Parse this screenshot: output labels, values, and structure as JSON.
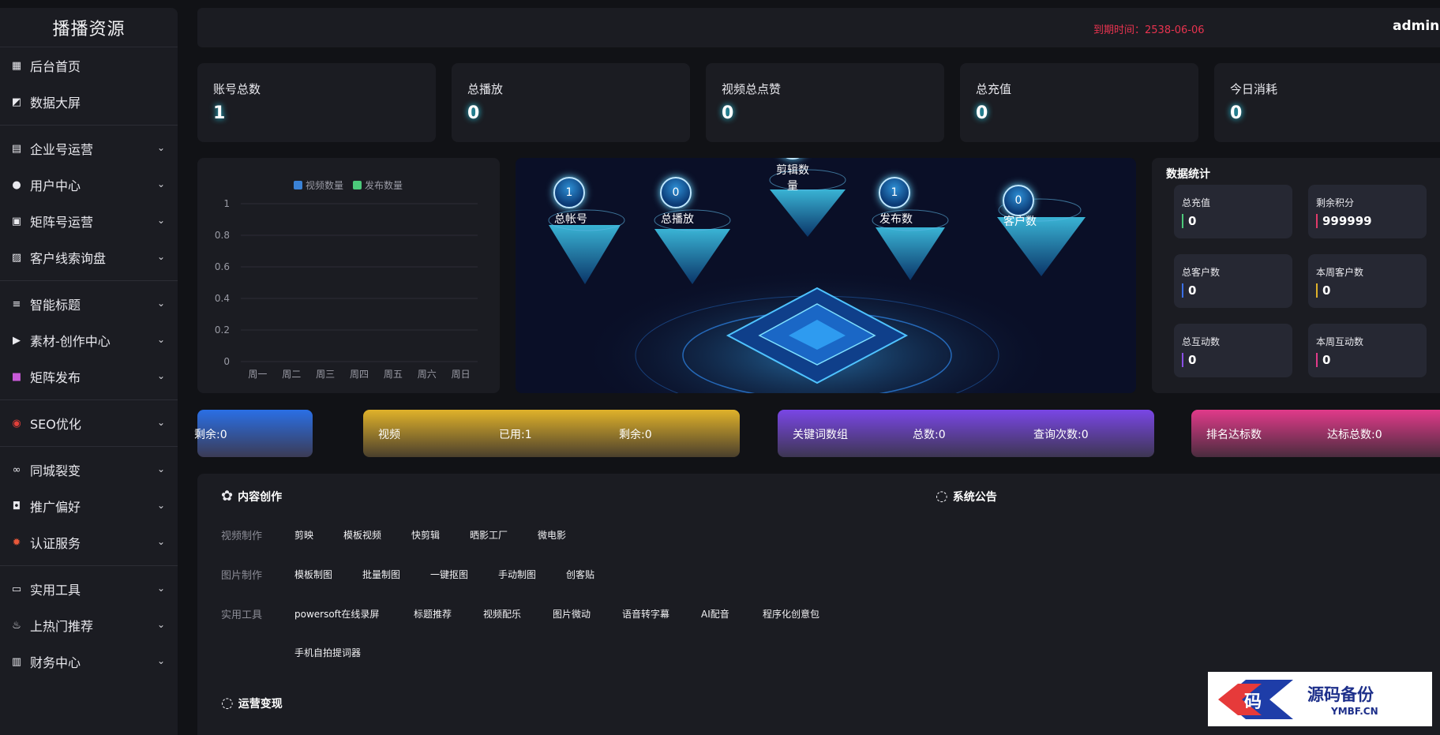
{
  "sidebar": {
    "brand": "播播资源",
    "items": [
      {
        "label": "后台首页",
        "icon": "dashboard-icon"
      },
      {
        "label": "数据大屏",
        "icon": "chart-icon"
      },
      {
        "label": "企业号运营",
        "icon": "building-icon"
      },
      {
        "label": "用户中心",
        "icon": "user-icon"
      },
      {
        "label": "矩阵号运营",
        "icon": "matrix-icon"
      },
      {
        "label": "客户线索询盘",
        "icon": "image-icon"
      },
      {
        "label": "智能标题",
        "icon": "list-icon"
      },
      {
        "label": "素材-创作中心",
        "icon": "play-icon"
      },
      {
        "label": "矩阵发布",
        "icon": "video-icon"
      },
      {
        "label": "SEO优化",
        "icon": "seo-icon"
      },
      {
        "label": "同城裂变",
        "icon": "link-icon"
      },
      {
        "label": "推广偏好",
        "icon": "robot-icon"
      },
      {
        "label": "认证服务",
        "icon": "badge-icon"
      },
      {
        "label": "实用工具",
        "icon": "toolbox-icon"
      },
      {
        "label": "上热门推荐",
        "icon": "fire-icon"
      },
      {
        "label": "财务中心",
        "icon": "wallet-icon"
      }
    ]
  },
  "topbar": {
    "expire": "到期时间：2538-06-06",
    "user": "admin"
  },
  "stats": [
    {
      "label": "账号总数",
      "value": "1"
    },
    {
      "label": "总播放",
      "value": "0"
    },
    {
      "label": "视频总点赞",
      "value": "0"
    },
    {
      "label": "总充值",
      "value": "0"
    },
    {
      "label": "今日消耗",
      "value": "0"
    }
  ],
  "chart_data": {
    "type": "bar",
    "categories": [
      "周一",
      "周二",
      "周三",
      "周四",
      "周五",
      "周六",
      "周日"
    ],
    "series": [
      {
        "name": "视频数量",
        "values": [
          0,
          0,
          0,
          0,
          0,
          0,
          0
        ],
        "color": "#3a82d6"
      },
      {
        "name": "发布数量",
        "values": [
          0,
          0,
          0,
          0,
          0,
          0,
          0
        ],
        "color": "#4cc97a"
      }
    ],
    "yticks": [
      "0",
      "0.2",
      "0.4",
      "0.6",
      "0.8",
      "1"
    ],
    "ylim": [
      0,
      1
    ],
    "legend": "top-center",
    "grid": true
  },
  "visual": {
    "items": [
      {
        "label": "总帐号",
        "value": "1"
      },
      {
        "label": "总播放",
        "value": "0"
      },
      {
        "label": "剪辑数量",
        "value": "0"
      },
      {
        "label": "发布数",
        "value": "1"
      },
      {
        "label": "客户数",
        "value": "0"
      }
    ]
  },
  "data_stats": {
    "title": "数据统计",
    "cards": [
      {
        "label": "总充值",
        "value": "0",
        "color": "#4cc97a"
      },
      {
        "label": "剩余积分",
        "value": "999999",
        "color": "#e13a6a"
      },
      {
        "label": "总客户数",
        "value": "0",
        "color": "#3a6fe6"
      },
      {
        "label": "本周客户数",
        "value": "0",
        "color": "#e0b22a"
      },
      {
        "label": "总互动数",
        "value": "0",
        "color": "#8a4fe6"
      },
      {
        "label": "本周互动数",
        "value": "0",
        "color": "#e13a8a"
      }
    ]
  },
  "strips": {
    "blue": {
      "remain": "剩余:0"
    },
    "yellow": {
      "name": "视频",
      "used": "已用:1",
      "remain": "剩余:0"
    },
    "purple": {
      "name": "关键词数组",
      "total": "总数:0",
      "queries": "查询次数:0"
    },
    "pink": {
      "name": "排名达标数",
      "total": "达标总数:0"
    }
  },
  "content": {
    "title": "内容创作",
    "notice_title": "系统公告",
    "ops_title": "运营变现",
    "rows": [
      {
        "label": "视频制作",
        "tools": [
          "剪映",
          "模板视频",
          "快剪辑",
          "晒影工厂",
          "微电影"
        ]
      },
      {
        "label": "图片制作",
        "tools": [
          "模板制图",
          "批量制图",
          "一键抠图",
          "手动制图",
          "创客贴"
        ]
      },
      {
        "label": "实用工具",
        "tools": [
          "powersoft在线录屏",
          "标题推荐",
          "视频配乐",
          "图片微动",
          "语音转字幕",
          "AI配音",
          "程序化创意包",
          "手机自拍提词器"
        ]
      }
    ]
  },
  "watermark": {
    "text_cn": "源码备份",
    "text_en": "YMBF.CN",
    "glyph": "码"
  }
}
